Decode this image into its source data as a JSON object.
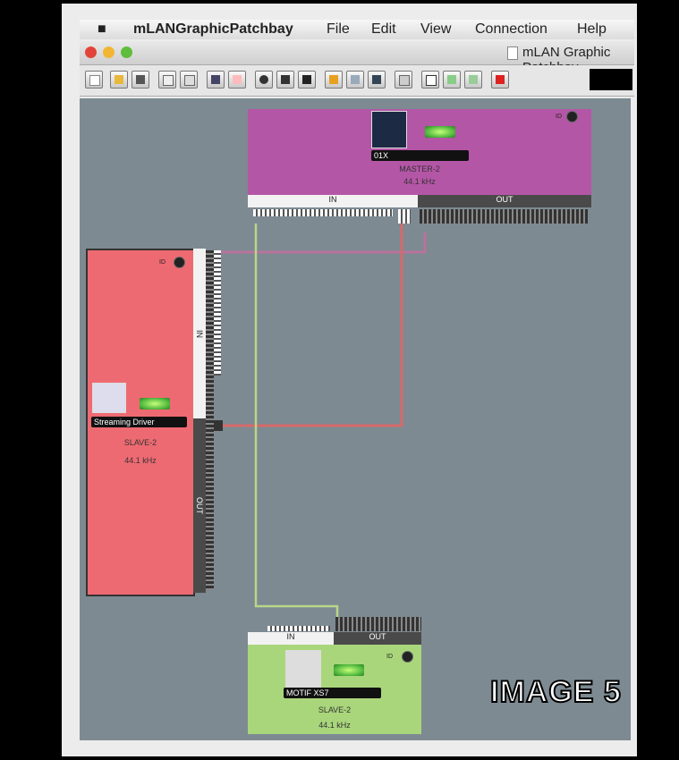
{
  "menubar": {
    "app_name": "mLANGraphicPatchbay",
    "items": [
      "File",
      "Edit",
      "View",
      "Connection",
      "Help"
    ]
  },
  "window": {
    "title": "mLAN Graphic Patchbay"
  },
  "toolbar": {
    "icons": [
      "new-icon",
      "open-icon",
      "save-icon",
      "copy-icon",
      "paste-icon",
      "device-list-icon",
      "wordclock-icon",
      "audio-icon",
      "midi-icon",
      "monitor-icon",
      "connect-icon",
      "disconnect-icon",
      "link-icon",
      "grid-icon",
      "window-icon",
      "refresh-icon",
      "settings-icon",
      "stop-icon"
    ]
  },
  "devices": {
    "master": {
      "name": "01X",
      "role": "MASTER-2",
      "rate": "44.1 kHz",
      "id_label": "ID",
      "in_label": "IN",
      "out_label": "OUT",
      "color": "#b456a6"
    },
    "streaming": {
      "name": "Streaming Driver",
      "role": "SLAVE-2",
      "rate": "44.1 kHz",
      "id_label": "ID",
      "in_label": "IN",
      "out_label": "OUT",
      "color": "#ee6a72"
    },
    "motif": {
      "name": "MOTIF XS7",
      "role": "SLAVE-2",
      "rate": "44.1 kHz",
      "id_label": "ID",
      "in_label": "IN",
      "out_label": "OUT",
      "color": "#a9d67b"
    }
  },
  "connections": {
    "colors": {
      "master_to_streaming": "#b8739c",
      "streaming_to_master": "#d66a6a",
      "master_to_motif": "#b7d68a"
    }
  },
  "caption": "IMAGE 5"
}
